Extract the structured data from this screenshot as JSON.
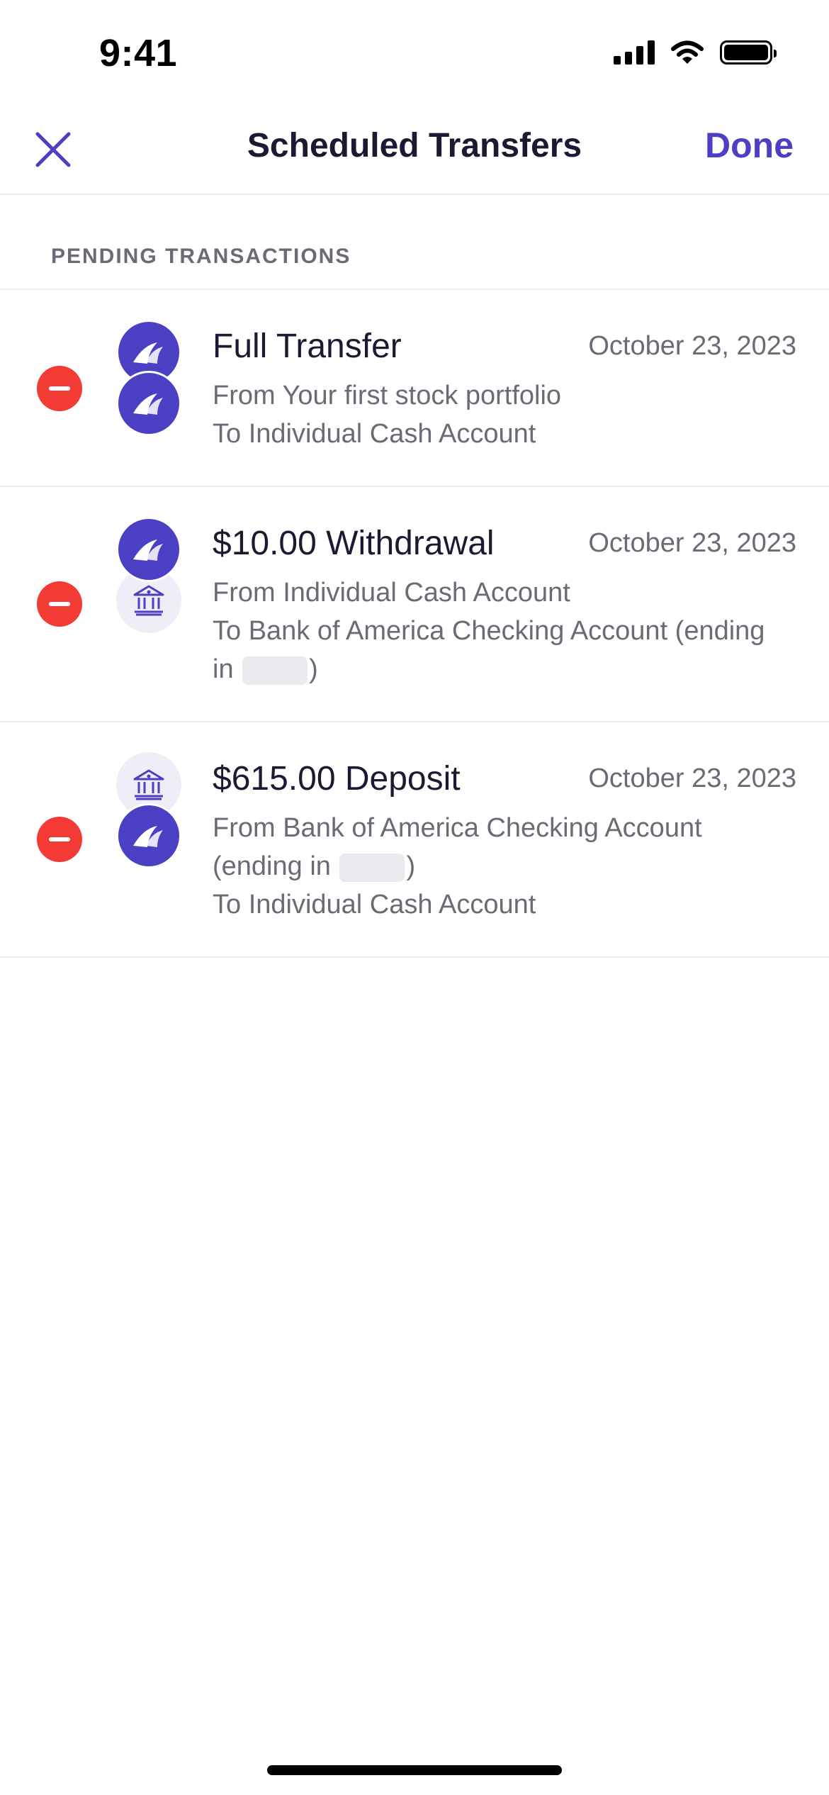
{
  "status_bar": {
    "time": "9:41"
  },
  "nav": {
    "title": "Scheduled Transfers",
    "done_label": "Done"
  },
  "section": {
    "title": "PENDING TRANSACTIONS"
  },
  "transactions": [
    {
      "title": "Full Transfer",
      "date": "October 23, 2023",
      "from": "From Your first stock portfolio",
      "to": "To Individual Cash Account"
    },
    {
      "title": "$10.00 Withdrawal",
      "date": "October 23, 2023",
      "from": "From Individual Cash Account",
      "to_line1": "To Bank of America Checking Account (ending",
      "to_line2_prefix": "in",
      "to_line2_suffix": ")"
    },
    {
      "title": "$615.00 Deposit",
      "date": "October 23, 2023",
      "from_line1": "From Bank of America Checking Account",
      "from_line2_prefix": "(ending in",
      "from_line2_suffix": ")",
      "to": "To Individual Cash Account"
    }
  ],
  "icons": {
    "close": "close-icon",
    "brand": "wealthfront-logo-icon",
    "bank": "bank-icon",
    "delete": "minus-circle-icon"
  },
  "colors": {
    "accent": "#4b3fc4",
    "delete": "#f33a35",
    "text_primary": "#1c1a33",
    "text_secondary": "#6b6a75"
  }
}
